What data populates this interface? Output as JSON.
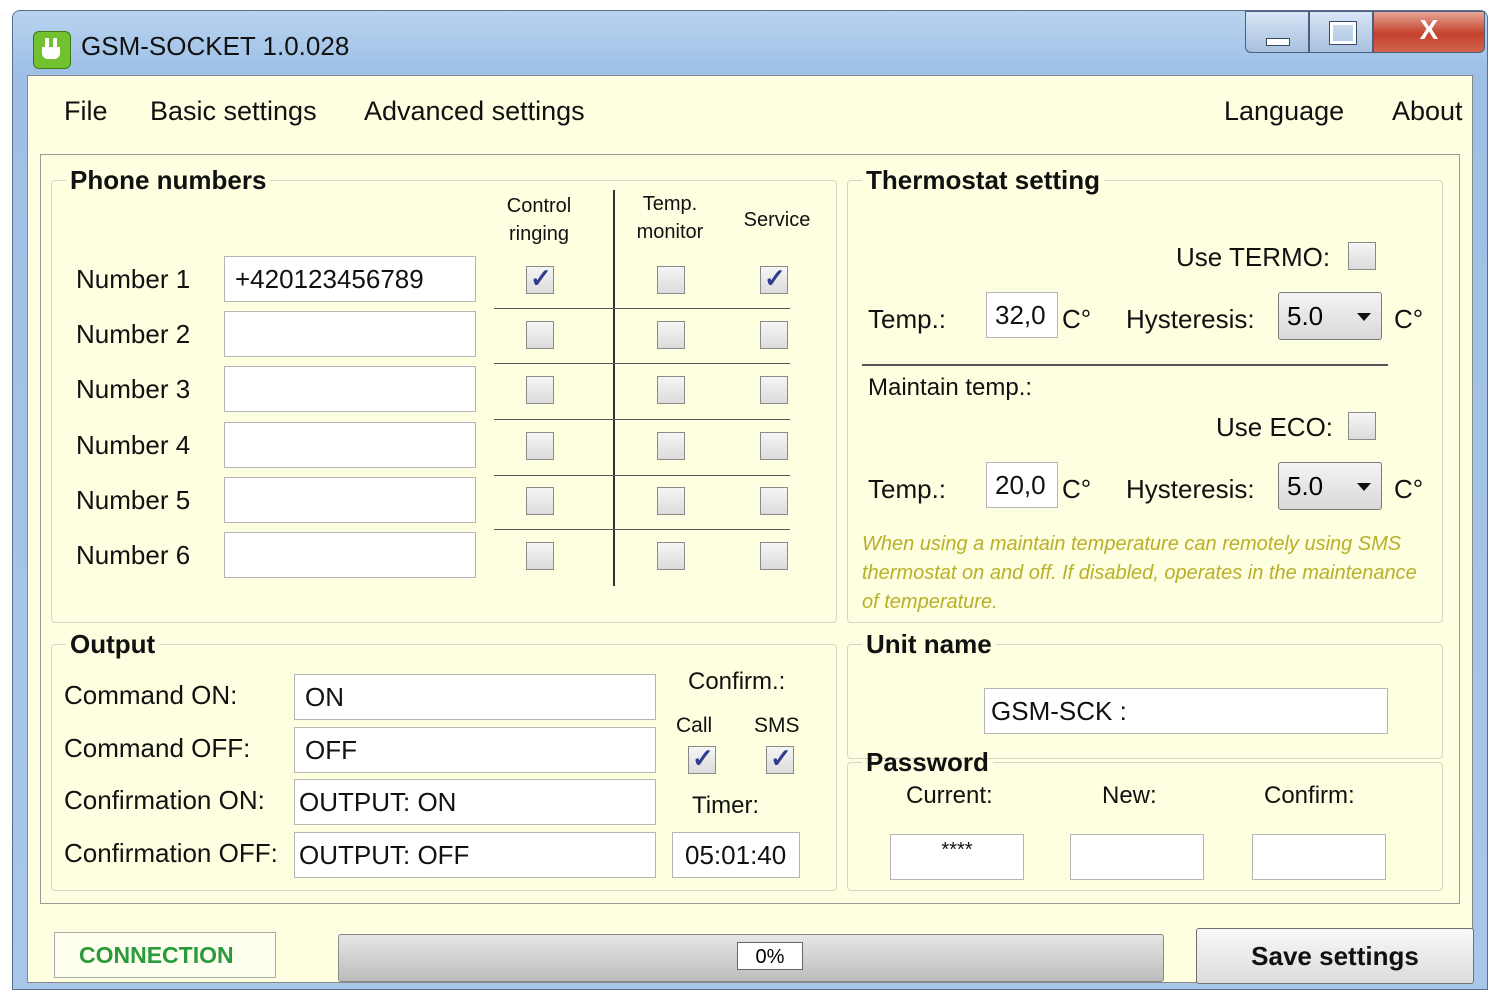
{
  "window": {
    "title": "GSM-SOCKET 1.0.028",
    "close_label": "X"
  },
  "menu": {
    "file": "File",
    "basic": "Basic settings",
    "advanced": "Advanced settings",
    "language": "Language",
    "about": "About"
  },
  "phone": {
    "title": "Phone numbers",
    "col_control": "Control ringing",
    "col_temp": "Temp. monitor",
    "col_service": "Service",
    "rows": [
      {
        "label": "Number 1",
        "value": "+420123456789",
        "control": true,
        "temp": false,
        "service": true
      },
      {
        "label": "Number 2",
        "value": "",
        "control": false,
        "temp": false,
        "service": false
      },
      {
        "label": "Number 3",
        "value": "",
        "control": false,
        "temp": false,
        "service": false
      },
      {
        "label": "Number 4",
        "value": "",
        "control": false,
        "temp": false,
        "service": false
      },
      {
        "label": "Number 5",
        "value": "",
        "control": false,
        "temp": false,
        "service": false
      },
      {
        "label": "Number 6",
        "value": "",
        "control": false,
        "temp": false,
        "service": false
      }
    ]
  },
  "thermo": {
    "title": "Thermostat setting",
    "use_termo": "Use TERMO:",
    "use_termo_checked": false,
    "temp_label": "Temp.:",
    "temp_value": "32,0",
    "unit": "C°",
    "hyst_label": "Hysteresis:",
    "hyst_value": "5.0",
    "maintain": "Maintain temp.:",
    "use_eco": "Use ECO:",
    "use_eco_checked": false,
    "temp2_value": "20,0",
    "hyst2_value": "5.0",
    "note": "When using a maintain temperature can remotely using SMS thermostat on and off. If disabled, operates in the maintenance of temperature."
  },
  "output": {
    "title": "Output",
    "cmd_on_label": "Command ON:",
    "cmd_on": "ON",
    "cmd_off_label": "Command OFF:",
    "cmd_off": "OFF",
    "conf_on_label": "Confirmation ON:",
    "conf_on": "OUTPUT: ON",
    "conf_off_label": "Confirmation OFF:",
    "conf_off": "OUTPUT: OFF",
    "confirm_label": "Confirm.:",
    "call_label": "Call",
    "call_checked": true,
    "sms_label": "SMS",
    "sms_checked": true,
    "timer_label": "Timer:",
    "timer": "05:01:40"
  },
  "unit": {
    "title": "Unit name",
    "value": "GSM-SCK :"
  },
  "password": {
    "title": "Password",
    "current_label": "Current:",
    "current": "****",
    "new_label": "New:",
    "new": "",
    "confirm_label": "Confirm:",
    "confirm": ""
  },
  "status": {
    "connection": "CONNECTION",
    "progress_text": "0%",
    "progress": 0,
    "save": "Save settings"
  }
}
